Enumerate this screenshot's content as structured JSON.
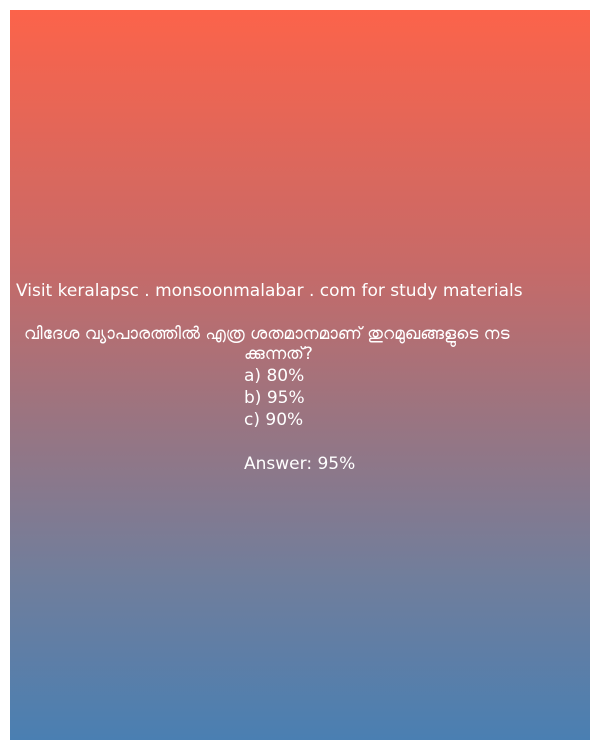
{
  "promo_text": "Visit keralapsc . monsoonmalabar . com for study materials",
  "question": {
    "line1": "വിദേശ വ്യാപാരത്തിൽ എത്ര ശതമാനമാണ് തുറമുഖങ്ങളുടെ നട",
    "line2": "ക്കുന്നത്?"
  },
  "options": [
    "a) 80%",
    "b) 95%",
    "c) 90%"
  ],
  "answer": "Answer: 95%",
  "colors": {
    "gradient_top": "#fc634a",
    "gradient_bottom": "#4a7fb2",
    "text": "#ffffff"
  }
}
